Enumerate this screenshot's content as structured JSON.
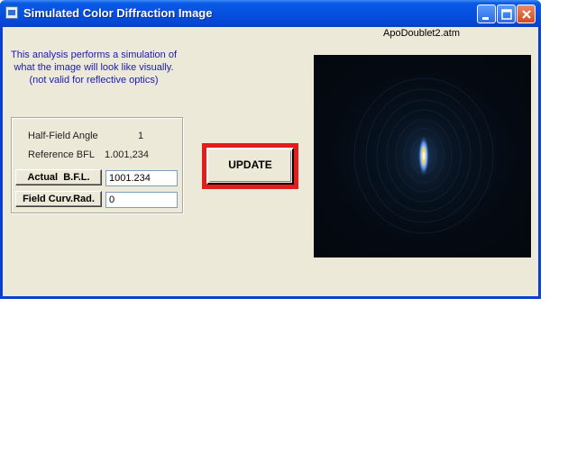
{
  "window": {
    "title": "Simulated Color Diffraction Image"
  },
  "file_label": "ApoDoublet2.atm",
  "description": [
    "This analysis performs a simulation of",
    "what the image will look like visually.",
    "(not valid for reflective optics)"
  ],
  "params": {
    "half_field_angle_label": "Half-Field Angle",
    "half_field_angle_value": "1",
    "reference_bfl_label": "Reference BFL",
    "reference_bfl_value": "1.001,234",
    "actual_bfl_label": "Actual  B.F.L.",
    "actual_bfl_value": "1001.234",
    "field_curv_label": "Field Curv.Rad.",
    "field_curv_value": "0"
  },
  "update_label": "UPDATE",
  "colors": {
    "title_bar": "#0650e0",
    "highlight_frame": "#e51c1c",
    "description_text": "#1a1ab0"
  }
}
